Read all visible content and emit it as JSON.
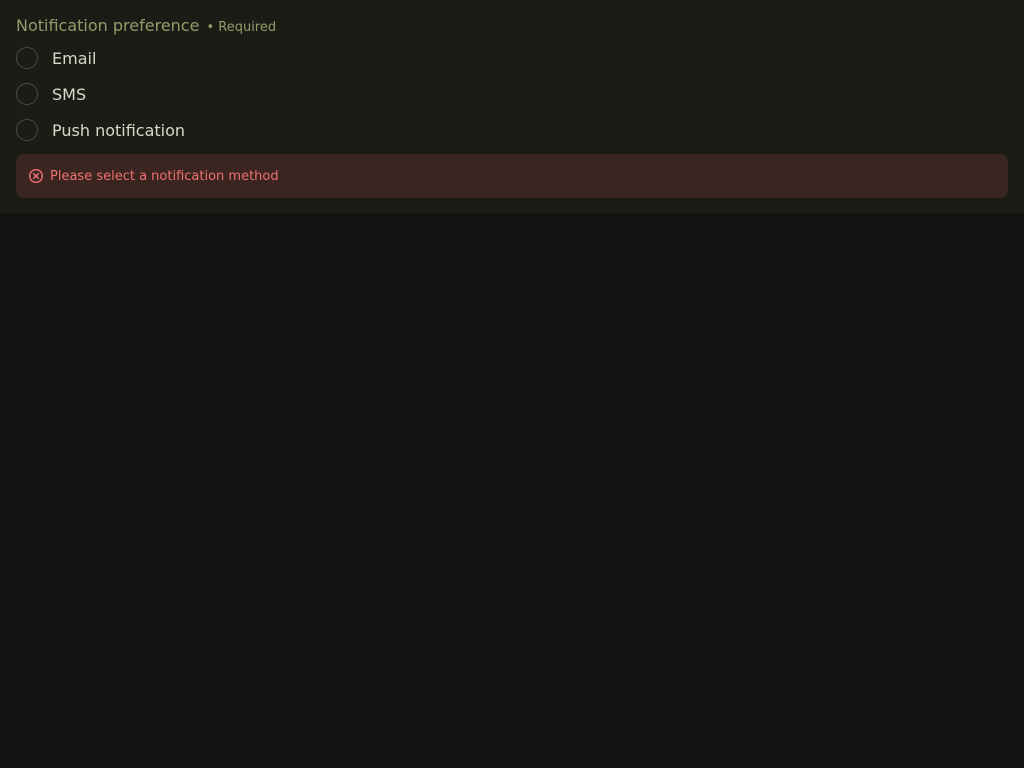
{
  "field": {
    "legend": "Notification preference",
    "required_text": "• Required"
  },
  "options": [
    {
      "label": "Email",
      "selected": false
    },
    {
      "label": "SMS",
      "selected": false
    },
    {
      "label": "Push notification",
      "selected": false
    }
  ],
  "error": {
    "icon": "error-circle-x-icon",
    "message": "Please select a notification method"
  },
  "colors": {
    "page_bg": "#121212",
    "panel_bg": "#1b1c16",
    "legend": "#8f9e6a",
    "option_text": "#d7d9c8",
    "error_bg": "#3a2520",
    "error_text": "#f07171"
  }
}
